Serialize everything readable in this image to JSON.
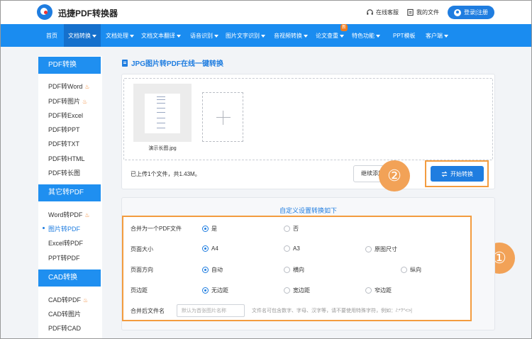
{
  "header": {
    "brand": "迅捷PDF转换器",
    "online_service": "在线客服",
    "my_files": "我的文件",
    "login": "登录|注册"
  },
  "nav": {
    "items": [
      "首页",
      "文档转换",
      "文档处理",
      "文档文本翻译",
      "语音识别",
      "图片文字识别",
      "音视频转换",
      "论文查重",
      "特色功能",
      "PPT模板",
      "客户端"
    ],
    "new_badge": "新"
  },
  "sidebar": {
    "pdf_convert": {
      "title": "PDF转换",
      "items": [
        "PDF转Word",
        "PDF转图片",
        "PDF转Excel",
        "PDF转PPT",
        "PDF转TXT",
        "PDF转HTML",
        "PDF转长图"
      ]
    },
    "other_to_pdf": {
      "title": "其它转PDF",
      "items": [
        "Word转PDF",
        "图片转PDF",
        "Excel转PDF",
        "PPT转PDF"
      ]
    },
    "cad_convert": {
      "title": "CAD转换",
      "items": [
        "CAD转PDF",
        "CAD转图片",
        "PDF转CAD"
      ]
    }
  },
  "main": {
    "title": "JPG图片转PDF在线一键转换",
    "upload": {
      "file_name": "演示长图.jpg",
      "status": "已上传1个文件，共1.43M。",
      "continue_label": "继续添加",
      "start_label": "开始转换"
    },
    "callouts": {
      "one": "①",
      "two": "②"
    },
    "settings": {
      "title": "自定义设置转换如下",
      "merge": {
        "label": "合并为一个PDF文件",
        "options": [
          "是",
          "否"
        ],
        "selected": "是"
      },
      "page_size": {
        "label": "页面大小",
        "options": [
          "A4",
          "A3",
          "原图尺寸"
        ],
        "selected": "A4"
      },
      "orientation": {
        "label": "页面方向",
        "options": [
          "自动",
          "横向",
          "纵向"
        ],
        "selected": "自动"
      },
      "margin": {
        "label": "页边距",
        "options": [
          "无边距",
          "宽边距",
          "窄边距"
        ],
        "selected": "无边距"
      },
      "filename": {
        "label": "合并后文件名",
        "placeholder": "默认为首张图片名称",
        "hint": "文件名可包含数字、字母、汉字等，请不要使用特殊字符，例如：/:*?\"<>|"
      }
    }
  },
  "colors": {
    "primary": "#1f7de0",
    "nav": "#1a8cf0",
    "highlight": "#f39c3f",
    "callout": "#f2a257"
  }
}
